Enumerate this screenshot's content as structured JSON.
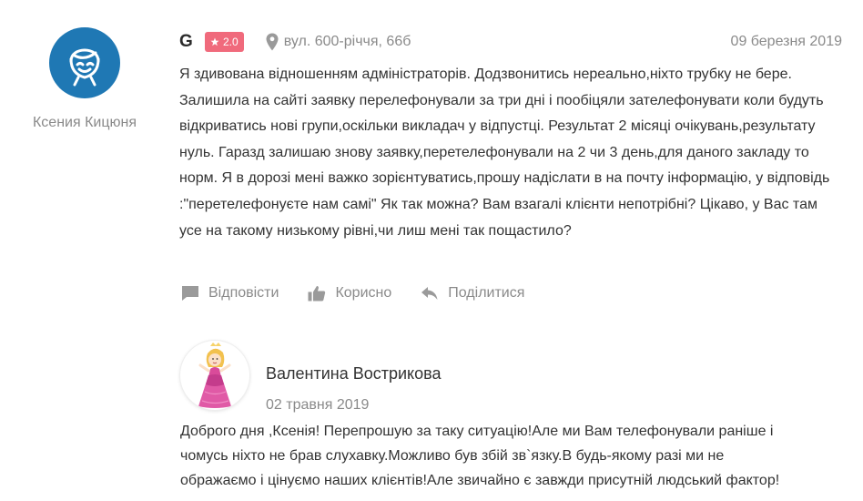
{
  "review": {
    "author_name": "Ксения Кицюня",
    "source_icon": "G",
    "rating": "2.0",
    "address": "вул. 600-річчя, 66б",
    "date": "09 березня 2019",
    "text": "Я здивована відношенням адміністраторів. Додзвонитись нереально,ніхто трубку не бере. Залишила на сайті заявку перелефонували за три дні і пообіцяли зателефонувати коли будуть відкриватись нові групи,оскільки викладач у відпустці. Результат 2 місяці очікувань,результату нуль. Гаразд залишаю знову заявку,перетелефонували на 2 чи 3 день,для даного закладу то норм. Я в дорозі мені важко зорієнтуватись,прошу надіслати в на почту інформацію, у відповідь :\"перетелефонуєте нам самі\" Як так можна? Вам взагалі клієнти непотрібні? Цікаво, у Вас там усе на такому низькому рівні,чи лиш мені так пощастило?",
    "actions": {
      "reply": "Відповісти",
      "useful": "Корисно",
      "share": "Поділитися"
    },
    "avatar_icon": "smiling-face-icon",
    "avatar_color": "#1f78b4",
    "badge_color": "#f06a7c"
  },
  "reply": {
    "author_name": "Валентина Вострикова",
    "date": "02 травня 2019",
    "text": " Доброго дня ,Ксенія! Перепрошую за таку ситуацію!Але ми Вам телефонували раніше і\nчомусь ніхто не брав слухавку.Можливо був збій зв`язку.В будь-якому разі ми не\nображаємо і цінуємо наших клієнтів!Але звичайно є завжди присутній людський фактор!",
    "avatar_icon": "princess-illustration"
  }
}
